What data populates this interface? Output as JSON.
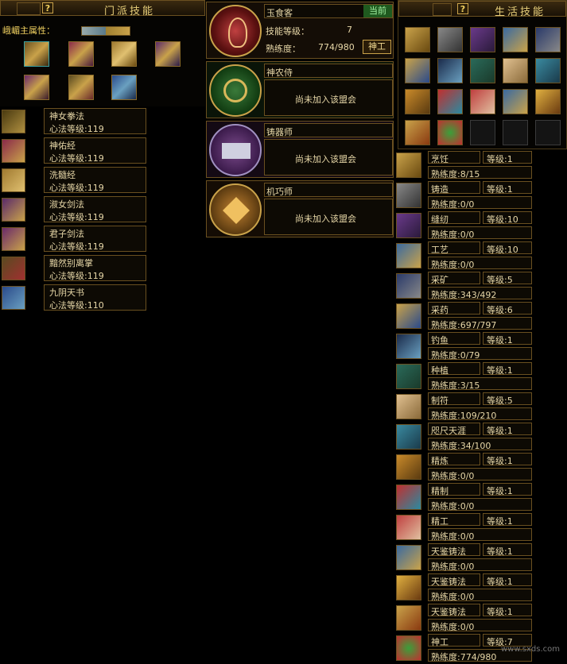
{
  "sect": {
    "title": "门派技能",
    "attr_label": "峨嵋主属性：",
    "skills": [
      {
        "name": "神女拳法",
        "level": "心法等级:119"
      },
      {
        "name": "神佑经",
        "level": "心法等级:119"
      },
      {
        "name": "洗髓经",
        "level": "心法等级:119"
      },
      {
        "name": "淑女剑法",
        "level": "心法等级:119"
      },
      {
        "name": "君子剑法",
        "level": "心法等级:119"
      },
      {
        "name": "黯然别离掌",
        "level": "心法等级:119"
      },
      {
        "name": "九阴天书",
        "level": "心法等级:110"
      }
    ]
  },
  "guilds": {
    "current": {
      "name": "玉食客",
      "status": "当前",
      "skill_level_label": "技能等级：",
      "skill_level_value": "7",
      "proficiency_label": "熟练度：",
      "proficiency_value": "774/980",
      "button": "神工"
    },
    "others": [
      {
        "name": "神农侍",
        "message": "尚未加入该盟会"
      },
      {
        "name": "铸器师",
        "message": "尚未加入该盟会"
      },
      {
        "name": "机巧师",
        "message": "尚未加入该盟会"
      }
    ]
  },
  "life": {
    "title": "生活技能",
    "skills": [
      {
        "name": "烹饪",
        "level": "等级:1",
        "prof": "熟练度:8/15"
      },
      {
        "name": "铸造",
        "level": "等级:1",
        "prof": "熟练度:0/0"
      },
      {
        "name": "缝纫",
        "level": "等级:10",
        "prof": "熟练度:0/0"
      },
      {
        "name": "工艺",
        "level": "等级:10",
        "prof": "熟练度:0/0"
      },
      {
        "name": "采矿",
        "level": "等级:5",
        "prof": "熟练度:343/492"
      },
      {
        "name": "采药",
        "level": "等级:6",
        "prof": "熟练度:697/797"
      },
      {
        "name": "钓鱼",
        "level": "等级:1",
        "prof": "熟练度:0/79"
      },
      {
        "name": "种植",
        "level": "等级:1",
        "prof": "熟练度:3/15"
      },
      {
        "name": "制符",
        "level": "等级:5",
        "prof": "熟练度:109/210"
      },
      {
        "name": "咫尺天涯",
        "level": "等级:1",
        "prof": "熟练度:34/100"
      },
      {
        "name": "精炼",
        "level": "等级:1",
        "prof": "熟练度:0/0"
      },
      {
        "name": "精制",
        "level": "等级:1",
        "prof": "熟练度:0/0"
      },
      {
        "name": "精工",
        "level": "等级:1",
        "prof": "熟练度:0/0"
      },
      {
        "name": "天鉴铸法",
        "level": "等级:1",
        "prof": "熟练度:0/0"
      },
      {
        "name": "天鉴铸法",
        "level": "等级:1",
        "prof": "熟练度:0/0"
      },
      {
        "name": "天鉴铸法",
        "level": "等级:1",
        "prof": "熟练度:0/0"
      },
      {
        "name": "神工",
        "level": "等级:7",
        "prof": "熟练度:774/980"
      }
    ]
  },
  "watermark": "www.sxds.com",
  "colors": {
    "gold": "#c9a24a",
    "panel": "#050402",
    "accent": "#3a9a3a"
  }
}
